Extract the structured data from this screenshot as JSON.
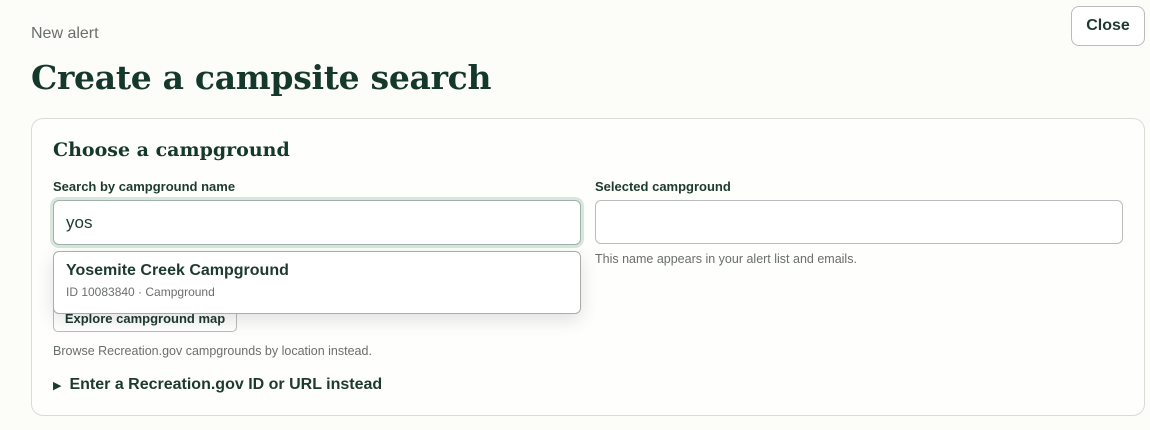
{
  "header": {
    "eyebrow": "New alert",
    "title": "Create a campsite search",
    "close_label": "Close"
  },
  "campground_section": {
    "title": "Choose a campground",
    "search_label": "Search by campground name",
    "search_value": "yos",
    "selected_label": "Selected campground",
    "selected_value": "",
    "selected_helper": "This name appears in your alert list and emails.",
    "map_button_label": "Explore campground map",
    "map_helper": "Browse Recreation.gov campgrounds by location instead.",
    "disclosure_icon": "triangle-right-icon",
    "disclosure_label": "Enter a Recreation.gov ID or URL instead"
  },
  "autocomplete": {
    "options": [
      {
        "name": "Yosemite Creek Campground",
        "meta": "ID 10083840 · Campground"
      }
    ]
  },
  "colors": {
    "background": "#fcfcf9",
    "heading": "#15382c",
    "text": "#1d3a2f",
    "muted": "#6a6f6c",
    "border": "#b9bdb9",
    "focus_ring": "#d9e6df"
  }
}
